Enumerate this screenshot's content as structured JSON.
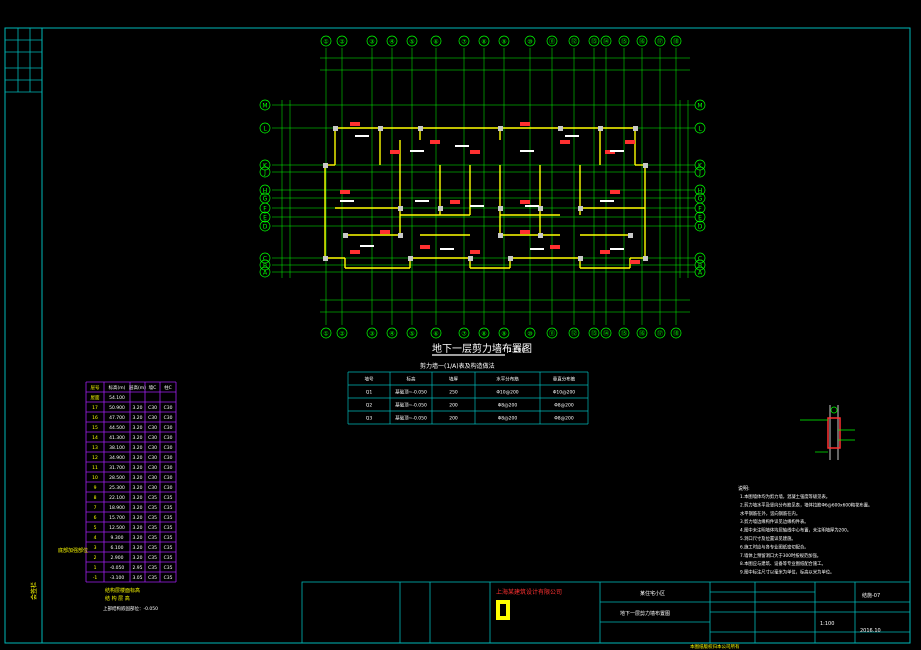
{
  "colors": {
    "background": "#000000",
    "frame": "#00b8b8",
    "axis": "#00ff00",
    "wall": "#ffff00",
    "column": "#c8c8c8",
    "annotation": "#ff3030",
    "table_grid": "#a020f0",
    "text": "#ffffff"
  },
  "plan": {
    "title": "地下一层剪力墙布置图",
    "scale": "1:100",
    "axis_labels_top": [
      "①",
      "②",
      "③",
      "④",
      "⑤",
      "⑥",
      "⑦",
      "⑧",
      "⑨",
      "⑩",
      "⑪",
      "⑫",
      "⑬",
      "⑭",
      "⑮",
      "⑯",
      "⑰",
      "⑱"
    ],
    "axis_labels_left": [
      "M",
      "L",
      "K",
      "J",
      "H",
      "G",
      "F",
      "E",
      "D",
      "C",
      "B",
      "A"
    ]
  },
  "wall_table": {
    "caption": "剪力墙一(1/A)表及构造做法",
    "headers": [
      "墙号",
      "标高",
      "墙厚",
      "水平分布筋",
      "垂直分布筋"
    ],
    "rows": [
      [
        "Q1",
        "基础顶~-0.050",
        "250",
        "Φ10@200",
        "Φ10@200"
      ],
      [
        "Q2",
        "基础顶~-0.050",
        "200",
        "Φ8@200",
        "Φ8@200"
      ],
      [
        "Q3",
        "基础顶~-0.050",
        "200",
        "Φ8@200",
        "Φ8@200"
      ]
    ]
  },
  "floor_table": {
    "headers": [
      "层号",
      "标高(m)",
      "层高(m)",
      "墙C",
      "柱C"
    ],
    "rows": [
      [
        "屋面",
        "54.100",
        "",
        "",
        ""
      ],
      [
        "17",
        "50.900",
        "3.20",
        "C30",
        "C30"
      ],
      [
        "16",
        "47.700",
        "3.20",
        "C30",
        "C30"
      ],
      [
        "15",
        "44.500",
        "3.20",
        "C30",
        "C30"
      ],
      [
        "14",
        "41.300",
        "3.20",
        "C30",
        "C30"
      ],
      [
        "13",
        "38.100",
        "3.20",
        "C30",
        "C30"
      ],
      [
        "12",
        "34.900",
        "3.20",
        "C30",
        "C30"
      ],
      [
        "11",
        "31.700",
        "3.20",
        "C30",
        "C30"
      ],
      [
        "10",
        "28.500",
        "3.20",
        "C30",
        "C30"
      ],
      [
        "9",
        "25.300",
        "3.20",
        "C30",
        "C30"
      ],
      [
        "8",
        "22.100",
        "3.20",
        "C35",
        "C35"
      ],
      [
        "7",
        "18.900",
        "3.20",
        "C35",
        "C35"
      ],
      [
        "6",
        "15.700",
        "3.20",
        "C35",
        "C35"
      ],
      [
        "5",
        "12.500",
        "3.20",
        "C35",
        "C35"
      ],
      [
        "4",
        "9.300",
        "3.20",
        "C35",
        "C35"
      ],
      [
        "3",
        "6.100",
        "3.20",
        "C35",
        "C35"
      ],
      [
        "2",
        "2.900",
        "3.20",
        "C35",
        "C35"
      ],
      [
        "1",
        "-0.050",
        "2.95",
        "C35",
        "C35"
      ],
      [
        "-1",
        "-3.100",
        "3.05",
        "C35",
        "C35"
      ]
    ],
    "side_label": "底部加强部位",
    "footer_title": "结构层楼面标高",
    "footer_sub": "结 构 层 高",
    "footer_note": "上部结构嵌固部位：-0.050"
  },
  "notes": {
    "heading": "说明:",
    "items": [
      "1.本图墙体均为剪力墙，混凝土强度等级见表。",
      "2.剪力墙水平及竖向分布筋见表，墙体拉筋Φ6@600x600梅花布置。",
      "   水平钢筋在外，竖向钢筋在内。",
      "3.剪力墙边缘构件详见边缘构件表。",
      "4.图中未注明墙体均居轴线中心布置，未注明墙厚为200。",
      "5.洞口尺寸及位置详见建施。",
      "6.施工时应与各专业图纸密切配合。",
      "7.墙体上预留洞口大于300时按规范加强。",
      "8.本图应与建筑、设备等专业图纸配合施工。",
      "9.图中标注尺寸以毫米为单位，标高以米为单位。"
    ]
  },
  "title_block": {
    "company": "上海某建筑设计有限公司",
    "project": "某住宅小区",
    "drawing_name": "地下一层剪力墙布置图",
    "drawing_no": "结施-07",
    "scale": "1:100",
    "date": "2016.10",
    "left_strip_label": "会签栏"
  },
  "bottom_caption": "本图纸版权归本公司所有"
}
